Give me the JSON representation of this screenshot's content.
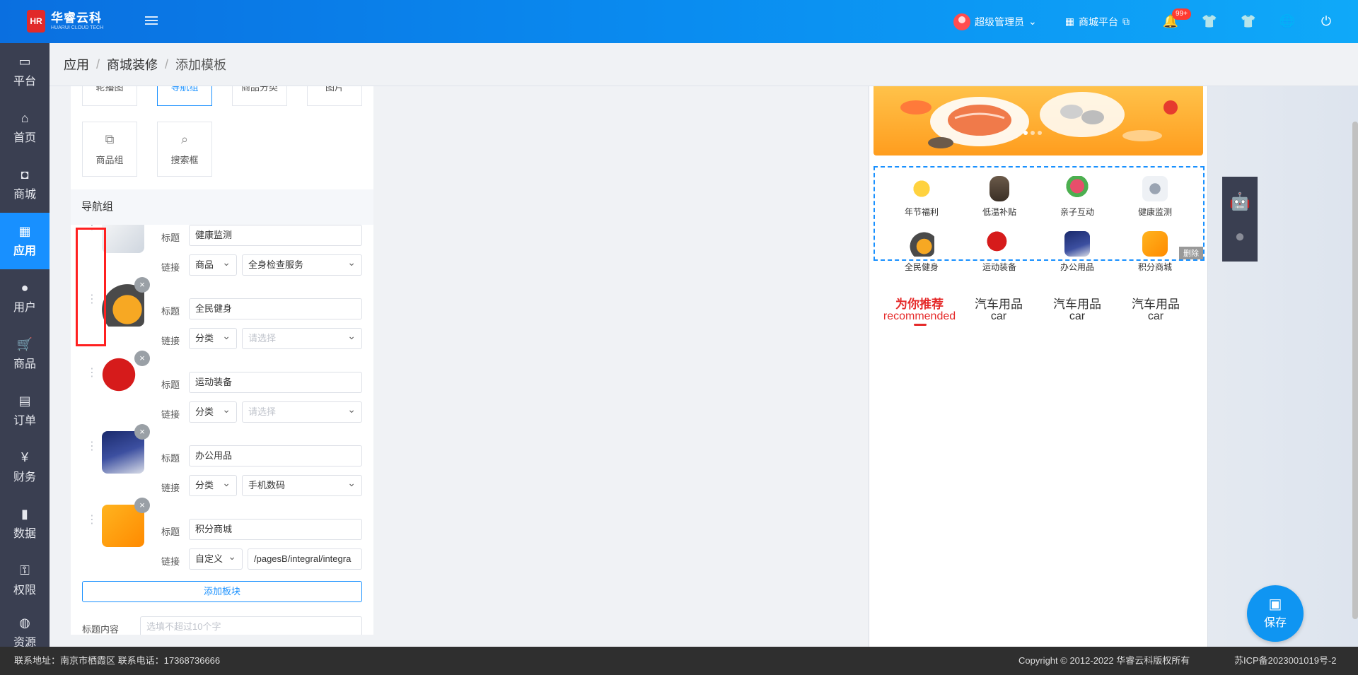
{
  "app": {
    "logo_mark": "HR",
    "logo_name": "华睿云科",
    "logo_sub": "HUARUI CLOUD TECH"
  },
  "topbar": {
    "user_name": "超级管理员",
    "shop_label": "商城平台",
    "notification_count": "99+"
  },
  "sidebar": {
    "items": [
      {
        "label": "平台",
        "icon": "monitor-icon"
      },
      {
        "label": "首页",
        "icon": "home-icon"
      },
      {
        "label": "商城",
        "icon": "shopping-bag-icon"
      },
      {
        "label": "应用",
        "icon": "apps-icon"
      },
      {
        "label": "用户",
        "icon": "user-icon"
      },
      {
        "label": "商品",
        "icon": "cart-icon"
      },
      {
        "label": "订单",
        "icon": "order-icon"
      },
      {
        "label": "财务",
        "icon": "finance-icon"
      },
      {
        "label": "数据",
        "icon": "chart-icon"
      },
      {
        "label": "权限",
        "icon": "permission-icon"
      },
      {
        "label": "资源",
        "icon": "resource-icon"
      }
    ],
    "active_index": 3
  },
  "breadcrumb": {
    "items": [
      "应用",
      "商城装修",
      "添加模板"
    ]
  },
  "components": {
    "items": [
      {
        "label": "轮播图"
      },
      {
        "label": "导航组"
      },
      {
        "label": "商品分类"
      },
      {
        "label": "图片"
      },
      {
        "label": "商品组"
      },
      {
        "label": "搜索框"
      }
    ],
    "active_label": "导航组"
  },
  "editor": {
    "section_title": "导航组",
    "title_label": "标题",
    "link_label": "链接",
    "rows": [
      {
        "title": "健康监测",
        "link_type": "商品",
        "link_target": "全身检查服务",
        "target_is_placeholder": false
      },
      {
        "title": "全民健身",
        "link_type": "分类",
        "link_target": "请选择",
        "target_is_placeholder": true
      },
      {
        "title": "运动装备",
        "link_type": "分类",
        "link_target": "请选择",
        "target_is_placeholder": true
      },
      {
        "title": "办公用品",
        "link_type": "分类",
        "link_target": "手机数码",
        "target_is_placeholder": false
      },
      {
        "title": "积分商城",
        "link_type": "自定义",
        "link_target": "/pagesB/integral/integra",
        "target_is_placeholder": false
      }
    ],
    "add_button": "添加板块",
    "title_content_label": "标题内容",
    "title_content_placeholder": "选填不超过10个字"
  },
  "preview": {
    "nav_items": [
      {
        "label": "年节福利"
      },
      {
        "label": "低温补贴"
      },
      {
        "label": "亲子互动"
      },
      {
        "label": "健康监测"
      },
      {
        "label": "全民健身"
      },
      {
        "label": "运动装备"
      },
      {
        "label": "办公用品"
      },
      {
        "label": "积分商城"
      }
    ],
    "delete_tag": "删除",
    "tabs": [
      {
        "title": "为你推荐",
        "subtitle": "recommended",
        "active": true
      },
      {
        "title": "汽车用品",
        "subtitle": "car",
        "active": false
      },
      {
        "title": "汽车用品",
        "subtitle": "car",
        "active": false
      },
      {
        "title": "汽车用品",
        "subtitle": "car",
        "active": false
      }
    ]
  },
  "save_button": "保存",
  "footer": {
    "contact": "联系地址：南京市栖霞区 联系电话：17368736666",
    "copyright": "Copyright © 2012-2022 华睿云科版权所有",
    "icp": "苏ICP备2023001019号-2"
  },
  "colors": {
    "primary": "#1890ff",
    "sidebar_bg": "#3a3f51",
    "accent_red": "#e52a2a"
  }
}
